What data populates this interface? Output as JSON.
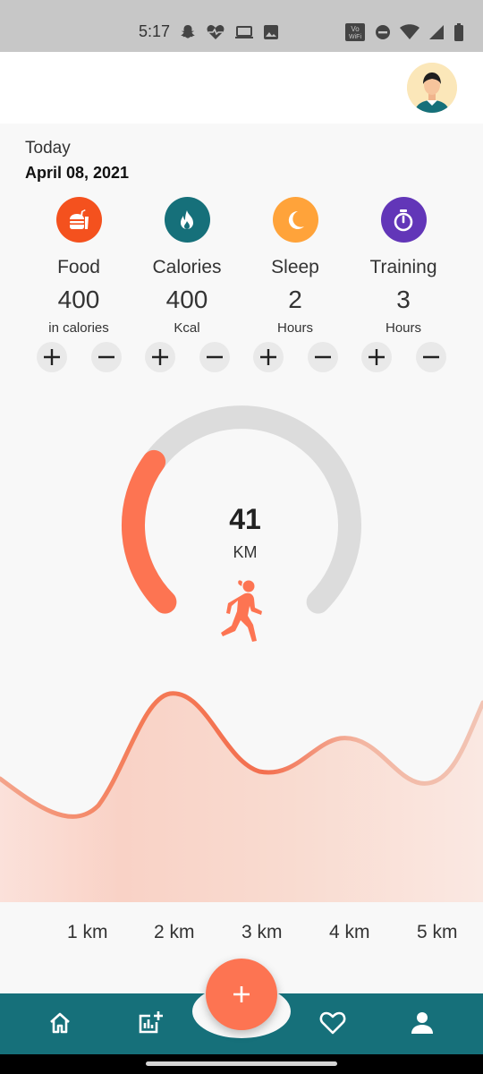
{
  "status_bar": {
    "time": "5:17",
    "left_icons": [
      "snapchat-icon",
      "heart-pulse-icon",
      "laptop-icon",
      "image-icon"
    ],
    "right_icons": [
      "vowifi-icon",
      "do-not-disturb-icon",
      "wifi-icon",
      "signal-icon",
      "battery-icon"
    ]
  },
  "header": {
    "avatar": "user-avatar"
  },
  "summary": {
    "today_label": "Today",
    "date": "April 08, 2021"
  },
  "stats": [
    {
      "label": "Food",
      "value": "400",
      "unit": "in calories",
      "icon": "food-icon",
      "color": "#f4511e"
    },
    {
      "label": "Calories",
      "value": "400",
      "unit": "Kcal",
      "icon": "flame-icon",
      "color": "#16707a"
    },
    {
      "label": "Sleep",
      "value": "2",
      "unit": "Hours",
      "icon": "moon-icon",
      "color": "#ffa33a"
    },
    {
      "label": "Training",
      "value": "3",
      "unit": "Hours",
      "icon": "stopwatch-icon",
      "color": "#6236b8"
    }
  ],
  "gauge": {
    "value": "41",
    "unit": "KM",
    "progress": 0.3,
    "accent": "#fd7452",
    "track": "#dcdcdc"
  },
  "distance_chart": {
    "labels": [
      "1 km",
      "2 km",
      "3 km",
      "4 km",
      "5 km"
    ]
  },
  "nav": {
    "items": [
      "home-icon",
      "stats-icon",
      "add-icon",
      "heart-icon",
      "profile-icon"
    ],
    "color": "#16707a"
  }
}
